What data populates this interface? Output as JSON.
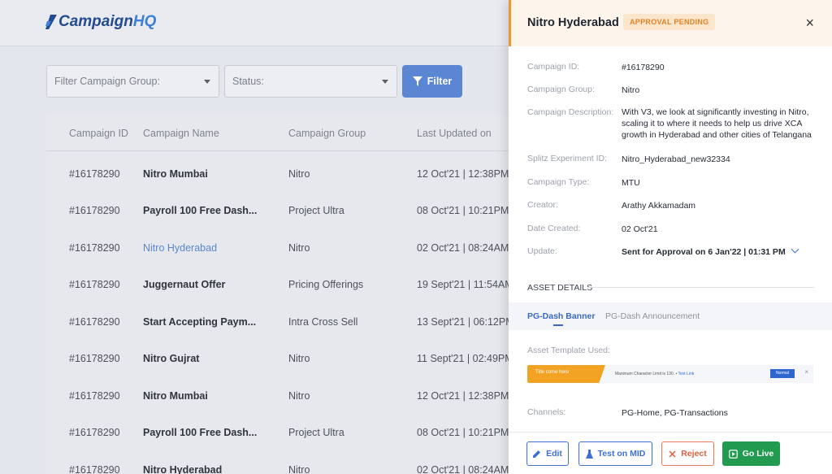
{
  "app": {
    "logo_main": "Campaign",
    "logo_accent": "HQ"
  },
  "filters": {
    "group_placeholder": "Filter Campaign Group:",
    "status_placeholder": "Status:",
    "filter_label": "Filter"
  },
  "table": {
    "headers": [
      "Campaign ID",
      "Campaign Name",
      "Campaign Group",
      "Last Updated on"
    ],
    "rows": [
      {
        "id": "#16178290",
        "name": "Nitro Mumbai",
        "group": "Nitro",
        "date": "12 Oct'21 | 12:38PM"
      },
      {
        "id": "#16178290",
        "name": "Payroll 100 Free Dash...",
        "group": "Project Ultra",
        "date": "08 Oct'21 | 10:21PM"
      },
      {
        "id": "#16178290",
        "name": "Nitro Hyderabad",
        "group": "Nitro",
        "date": "02 Oct'21 | 08:24AM"
      },
      {
        "id": "#16178290",
        "name": "Juggernaut Offer",
        "group": "Pricing Offerings",
        "date": "19 Sept'21 | 11:54AM"
      },
      {
        "id": "#16178290",
        "name": "Start Accepting Paym...",
        "group": "Intra Cross Sell",
        "date": "13 Sept'21 | 06:12PM"
      },
      {
        "id": "#16178290",
        "name": "Nitro Gujrat",
        "group": "Nitro",
        "date": "11 Sept'21 | 02:49PM"
      },
      {
        "id": "#16178290",
        "name": "Nitro Mumbai",
        "group": "Nitro",
        "date": "12 Oct'21 | 12:38PM"
      },
      {
        "id": "#16178290",
        "name": "Payroll 100 Free Dash...",
        "group": "Project Ultra",
        "date": "08 Oct'21 | 10:21PM"
      },
      {
        "id": "#16178290",
        "name": "Nitro Hyderabad",
        "group": "Nitro",
        "date": "02 Oct'21 | 08:24AM"
      }
    ]
  },
  "drawer": {
    "title": "Nitro Hyderabad",
    "badge": "APPROVAL PENDING",
    "close": "×",
    "fields": {
      "campaign_id_label": "Campaign ID:",
      "campaign_id": "#16178290",
      "campaign_group_label": "Campaign Group:",
      "campaign_group": "Nitro",
      "description_label": "Campaign Description:",
      "description": "With V3, we look at significantly investing in Nitro, scaling it to where it needs to help us drive XCA growth in Hyderabad and other cities of Telangana",
      "splitz_label": "Splitz Experiment ID:",
      "splitz": "Nitro_Hyderabad_new32334",
      "type_label": "Campaign Type:",
      "type": "MTU",
      "creator_label": "Creator:",
      "creator": "Arathy Akkamadam",
      "date_created_label": "Date Created:",
      "date_created": "02 Oct'21",
      "update_label": "Update:",
      "update": "Sent for Approval on 6 Jan'22 | 01:31 PM"
    },
    "asset_section": "ASSET DETAILS",
    "tabs": [
      "PG-Dash Banner",
      "PG-Dash Announcement"
    ],
    "asset_template_label": "Asset Template Used:",
    "template": {
      "title": "Title come here",
      "text": "Maximum Character Limit is 130.",
      "link": "Text Link",
      "button": "Normal",
      "close": "×"
    },
    "channels_label": "Channels:",
    "channels": "PG-Home, PG-Transactions",
    "actions": {
      "edit": "Edit",
      "test": "Test on MID",
      "reject": "Reject",
      "live": "Go Live"
    }
  },
  "colors": {
    "accent": "#3d70cf",
    "pending": "#e08326",
    "reject": "#e0603f",
    "live": "#229a4f"
  }
}
